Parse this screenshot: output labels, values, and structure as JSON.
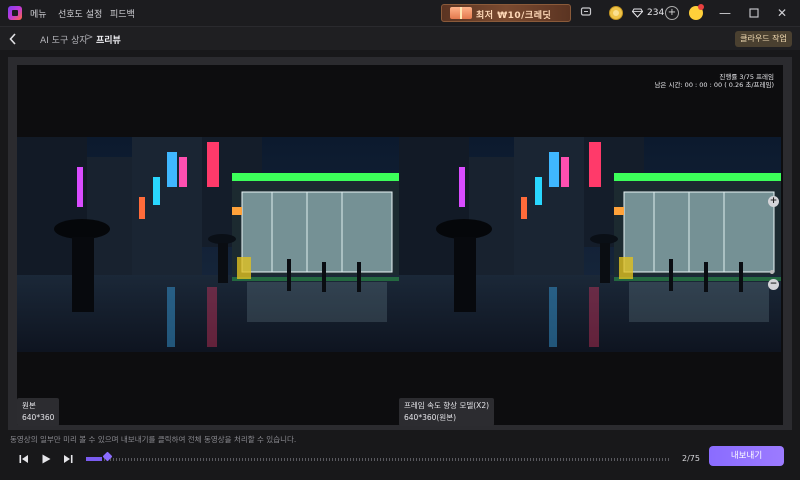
{
  "titlebar": {
    "menu": [
      "메뉴",
      "선호도 설정",
      "피드백"
    ],
    "promo_text": "최저 ₩10/크레딧",
    "credits": "234",
    "icons": [
      "app-logo",
      "gift-icon",
      "chat-icon",
      "coin-icon",
      "diamond-icon",
      "plus-icon",
      "avatar-icon",
      "minimize-icon",
      "maximize-icon",
      "close-icon"
    ]
  },
  "breadcrumb": {
    "parent": "AI 도구 상자",
    "separator": ">",
    "current": "프리뷰",
    "cloud_button": "클라우드 작업"
  },
  "preview": {
    "frame_line": "진행률 3/75 프레임",
    "time_line": "남은 시간: 00 : 00 : 00 ( 0.26 초/프레임)",
    "left_label_title": "원본",
    "left_label_res": "640*360",
    "right_label_title": "프레임 속도 향상 모델(X2)",
    "right_label_res": "640*360(원본)",
    "zoom_in": "+",
    "zoom_out": "−"
  },
  "footer": {
    "hint": "동영상의 일부만 미리 볼 수 있으며 내보내기를 클릭하여 전체 동영상을 처리할 수 있습니다.",
    "frame_counter": "2/75",
    "export_button": "내보내기",
    "progress_fraction": 0.027
  },
  "colors": {
    "accent": "#8b6cff",
    "background": "#18181a",
    "panel": "#2b2b2f"
  }
}
